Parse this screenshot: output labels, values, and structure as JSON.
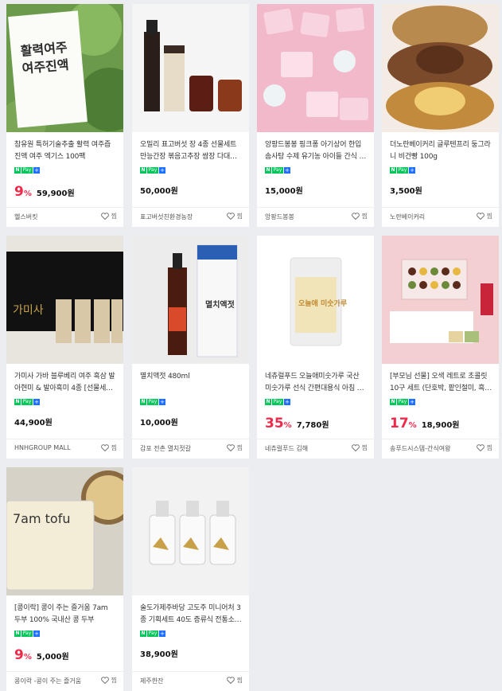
{
  "npay": {
    "n": "N",
    "pay": "Pay",
    "plus": "+"
  },
  "like_label": "찜",
  "products": [
    {
      "title": "참유원 특허기술추출 활력 여주즙 진액 여주 엑기스 100팩",
      "discount": "9",
      "price": "59,900원",
      "seller": "헬스버킷",
      "npay": true,
      "img_text": "활력여주 여주진액"
    },
    {
      "title": "오밀리 표고버섯 장 4종 선물세트 만능간장 볶음고추장 쌈장 다대…",
      "discount": "",
      "price": "50,000원",
      "seller": "표고버섯친환경농장",
      "npay": true,
      "img_text": ""
    },
    {
      "title": "앙팡드봉봉 핑크퐁 아기상어 한입 솜사탕 수제 유기농 아이들 간식 …",
      "discount": "",
      "price": "15,000원",
      "seller": "앙팡드봉봉",
      "npay": true,
      "img_text": ""
    },
    {
      "title": "더노란베이커리 글루텐프리 둥그라니 비건빵 100g",
      "discount": "",
      "price": "3,500원",
      "seller": "노란베이커리",
      "npay": true,
      "img_text": ""
    },
    {
      "title": "가미사 가바 블루베리 여주 흑삼 발아현미 & 발아흑미 4종 [선물세…",
      "discount": "",
      "price": "44,900원",
      "seller": "HNHGROUP MALL",
      "npay": true,
      "img_text": "가미사"
    },
    {
      "title": "멸치액젓 480ml",
      "discount": "",
      "price": "10,000원",
      "seller": "감포 전촌 멸치젓갈",
      "npay": true,
      "img_text": "멸치액젓"
    },
    {
      "title": "네츄럴푸드 오늘애미숫가루 국산 미숫가루 선식 간편대용식 아침 …",
      "discount": "35",
      "price": "7,780원",
      "seller": "네츄럴푸드 김해",
      "npay": true,
      "img_text": "오늘애 미숫가루"
    },
    {
      "title": "[부모님 선물] 오색 레트로 초콜릿 10구 세트 (단호박, 팥인절미, 흑…",
      "discount": "17",
      "price": "18,900원",
      "seller": "송푸드시스템-간식여왕",
      "npay": true,
      "img_text": ""
    },
    {
      "title": "[콩이락] 콩이 주는 즐거움 7am 두부 100% 국내산 콩 두부",
      "discount": "9",
      "price": "5,000원",
      "seller": "콩이락 -콩이 주는 즐거움",
      "npay": true,
      "img_text": "7am tofu"
    },
    {
      "title": "술도가제주바당 고도주 미니어처 3종 기획세트 40도 증류식 전통소…",
      "discount": "",
      "price": "38,900원",
      "seller": "제주한잔",
      "npay": true,
      "img_text": ""
    }
  ],
  "colors": {
    "discount": "#f0284a",
    "npay_green": "#03c75a",
    "background": "#ebedf0"
  }
}
